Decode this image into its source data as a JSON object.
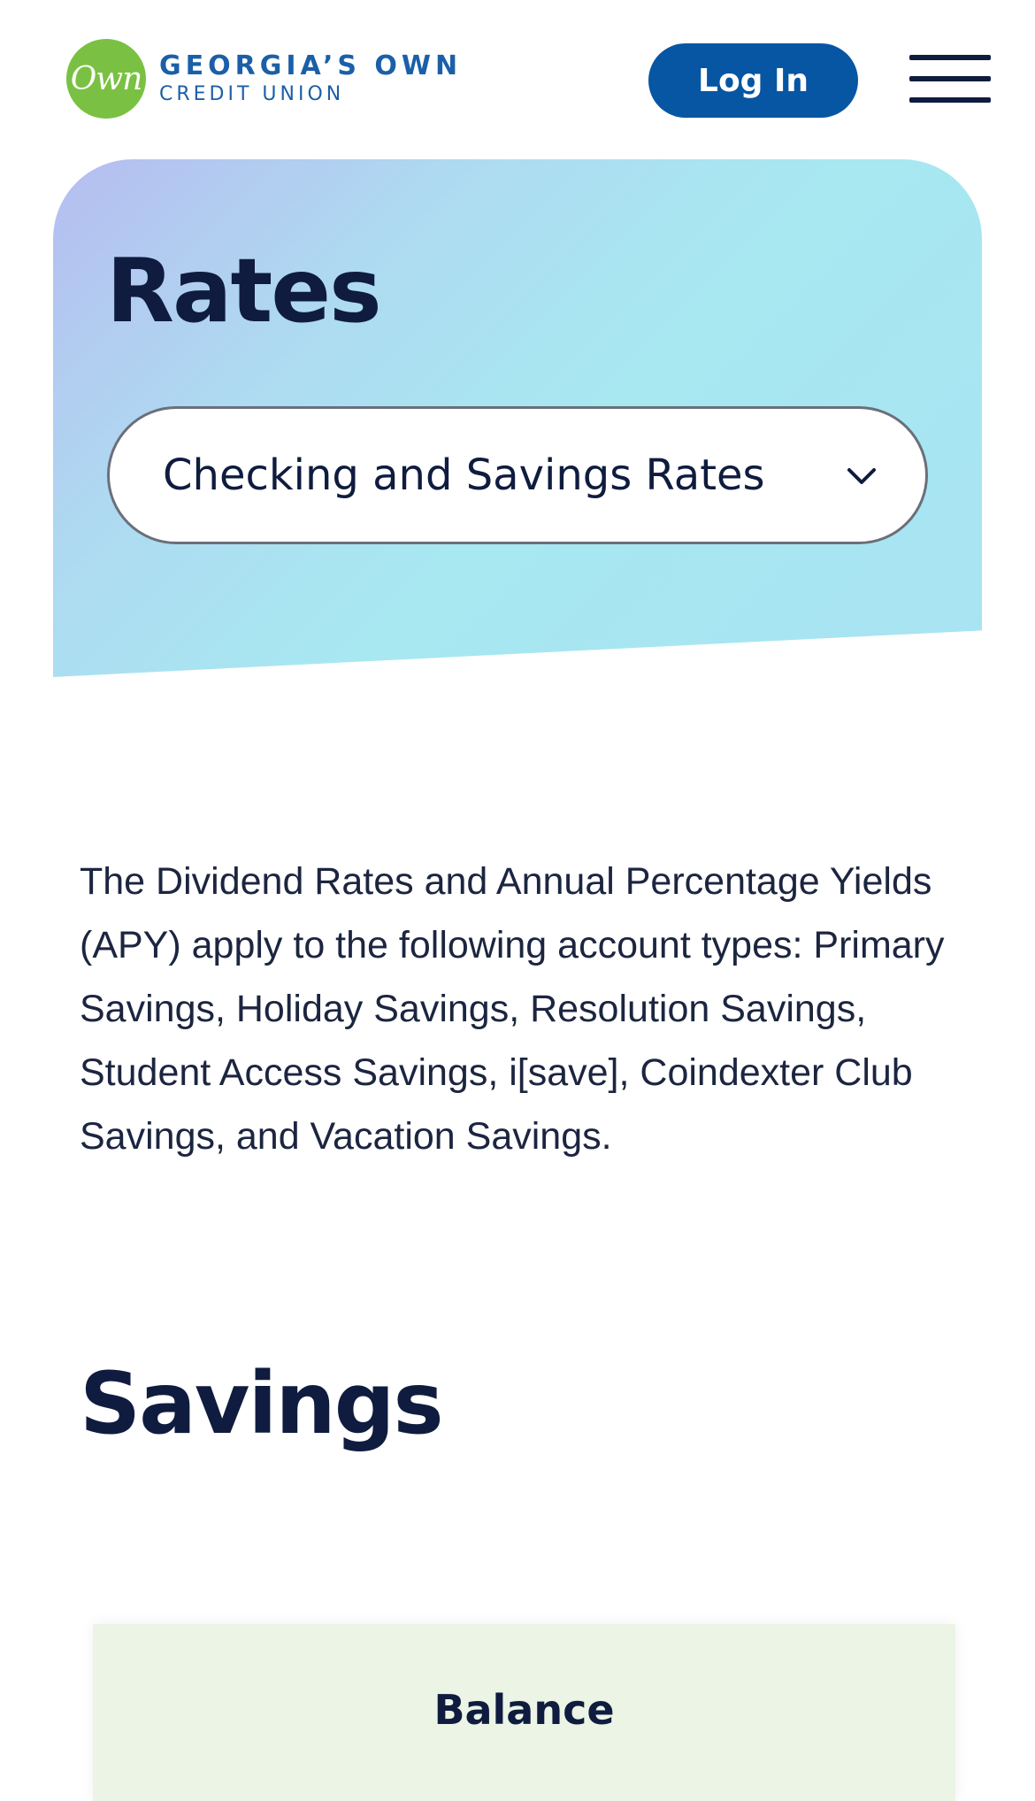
{
  "header": {
    "logo_mark": "Own",
    "logo_line1": "GEORGIA’S OWN",
    "logo_line2": "CREDIT UNION",
    "login_label": "Log In",
    "menu_icon": "hamburger-menu-icon"
  },
  "hero": {
    "title": "Rates",
    "select": {
      "value": "Checking and Savings Rates",
      "icon": "chevron-down-icon"
    }
  },
  "intro": "The Dividend Rates and Annual Percentage Yields (APY) apply to the following account types: Primary Savings, Holiday Savings, Resolution Savings, Student Access Savings, i[save], Coindexter Club Savings, and Vacation Savings.",
  "savings": {
    "title": "Savings",
    "table": {
      "columns": [
        "Balance"
      ]
    }
  },
  "colors": {
    "brand_blue": "#0756a3",
    "logo_green": "#7ac143",
    "heading_navy": "#0f1c3f",
    "table_header_bg": "#ecf4e5"
  }
}
